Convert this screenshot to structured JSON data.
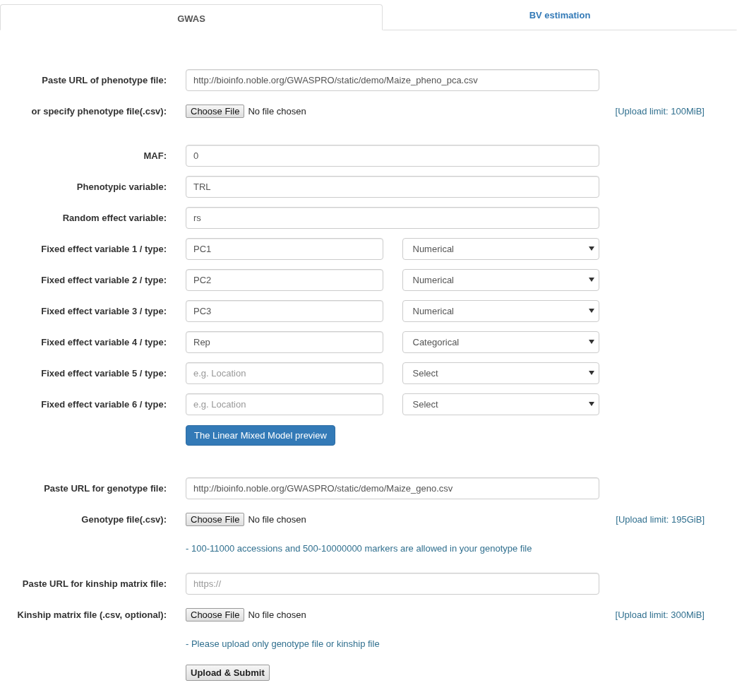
{
  "tabs": [
    {
      "label": "GWAS",
      "selected": true
    },
    {
      "label": "BV estimation",
      "selected": false
    }
  ],
  "sections": [
    {
      "rows": [
        {
          "kind": "text",
          "label": "Paste URL of phenotype file:",
          "value": "http://bioinfo.noble.org/GWASPRO/static/demo/Maize_pheno_pca.csv"
        },
        {
          "kind": "file",
          "label": "or specify phenotype file(.csv):",
          "button": "Choose File",
          "status": "No file chosen",
          "limit": "[Upload limit: 100MiB]"
        }
      ]
    },
    {
      "rows": [
        {
          "kind": "text",
          "label": "MAF:",
          "value": "0"
        },
        {
          "kind": "text",
          "label": "Phenotypic variable:",
          "value": "TRL"
        },
        {
          "kind": "text",
          "label": "Random effect variable:",
          "value": "rs"
        },
        {
          "kind": "pair",
          "label": "Fixed effect variable 1 / type:",
          "value": "PC1",
          "option": "Numerical"
        },
        {
          "kind": "pair",
          "label": "Fixed effect variable 2 / type:",
          "value": "PC2",
          "option": "Numerical"
        },
        {
          "kind": "pair",
          "label": "Fixed effect variable 3 / type:",
          "value": "PC3",
          "option": "Numerical"
        },
        {
          "kind": "pair",
          "label": "Fixed effect variable 4 / type:",
          "value": "Rep",
          "option": "Categorical"
        },
        {
          "kind": "pair",
          "label": "Fixed effect variable 5 / type:",
          "placeholder": "e.g. Location",
          "option": "Select"
        },
        {
          "kind": "pair",
          "label": "Fixed effect variable 6 / type:",
          "placeholder": "e.g. Location",
          "option": "Select"
        },
        {
          "kind": "button",
          "button": "The Linear Mixed Model preview"
        }
      ]
    },
    {
      "rows": [
        {
          "kind": "text",
          "label": "Paste URL for genotype file:",
          "value": "http://bioinfo.noble.org/GWASPRO/static/demo/Maize_geno.csv"
        },
        {
          "kind": "file",
          "label": "Genotype file(.csv):",
          "button": "Choose File",
          "status": "No file chosen",
          "limit": "[Upload limit: 195GiB]"
        },
        {
          "kind": "note",
          "text": "- 100-11000 accessions and 500-10000000 markers are allowed in your genotype file"
        }
      ]
    },
    {
      "rows": [
        {
          "kind": "text",
          "label": "Paste URL for kinship matrix file:",
          "placeholder": "https://"
        },
        {
          "kind": "file",
          "label": "Kinship matrix file (.csv, optional):",
          "button": "Choose File",
          "status": "No file chosen",
          "limit": "[Upload limit: 300MiB]"
        },
        {
          "kind": "note",
          "text": "- Please upload only genotype file or kinship file"
        },
        {
          "kind": "submit",
          "button": "Upload & Submit"
        }
      ]
    }
  ]
}
